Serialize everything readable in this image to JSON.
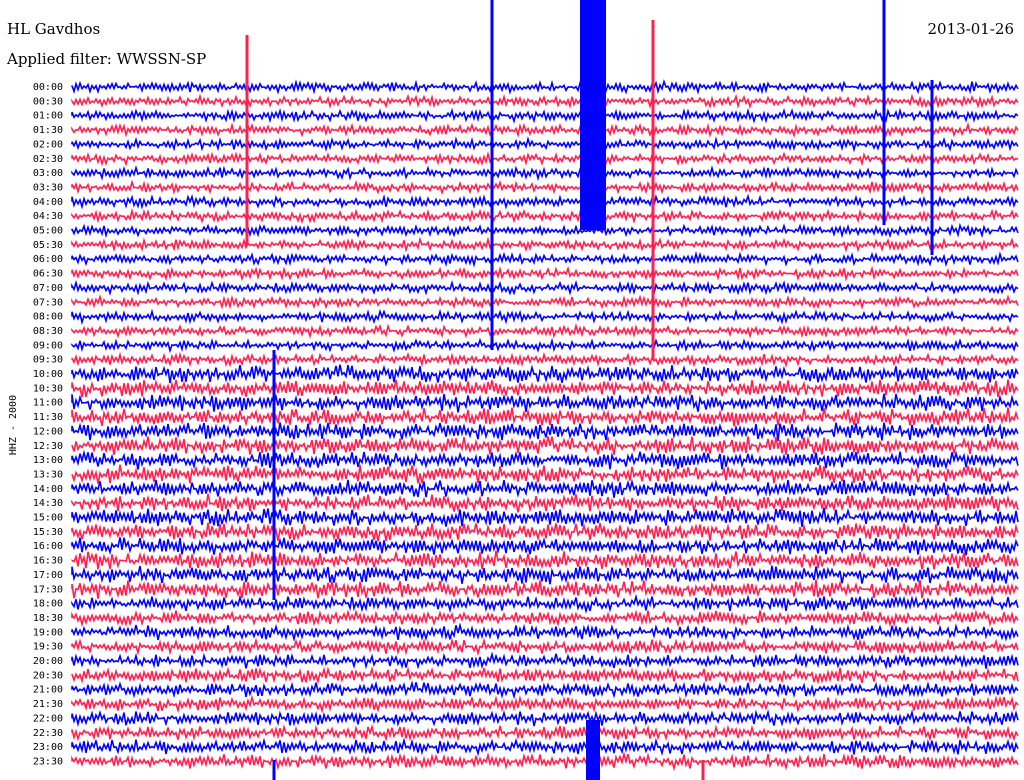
{
  "header": {
    "station": "HL Gavdhos",
    "filter": "Applied filter: WWSSN-SP",
    "date": "2013-01-26"
  },
  "chart_data": {
    "type": "line",
    "title": "HL Gavdhos",
    "subtitle": "Applied filter: WWSSN-SP",
    "date": "2013-01-26",
    "ylabel": "HHZ - 2000",
    "rows": [
      "00:00",
      "00:30",
      "01:00",
      "01:30",
      "02:00",
      "02:30",
      "03:00",
      "03:30",
      "04:00",
      "04:30",
      "05:00",
      "05:30",
      "06:00",
      "06:30",
      "07:00",
      "07:30",
      "08:00",
      "08:30",
      "09:00",
      "09:30",
      "10:00",
      "10:30",
      "11:00",
      "11:30",
      "12:00",
      "12:30",
      "13:00",
      "13:30",
      "14:00",
      "14:30",
      "15:00",
      "15:30",
      "16:00",
      "16:30",
      "17:00",
      "17:30",
      "18:00",
      "18:30",
      "19:00",
      "19:30",
      "20:00",
      "20:30",
      "21:00",
      "21:30",
      "22:00",
      "22:30",
      "23:00",
      "23:30"
    ],
    "row_colors": [
      "#0000ff",
      "#ff2050"
    ],
    "grid": false
  }
}
